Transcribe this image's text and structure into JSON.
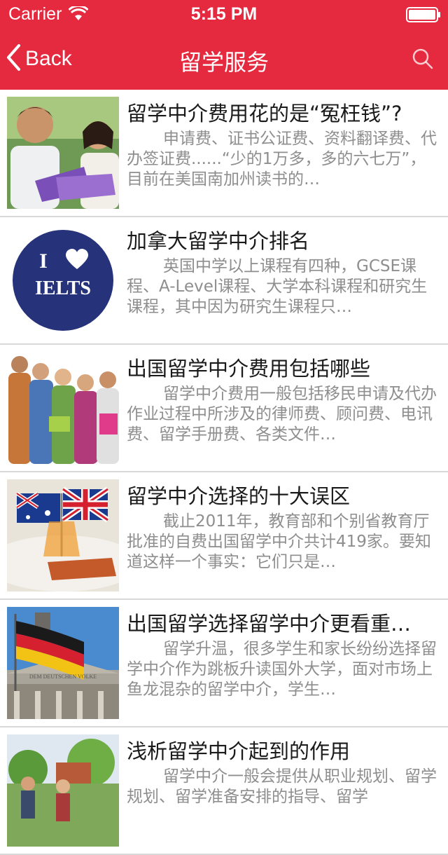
{
  "status_bar": {
    "carrier": "Carrier",
    "time": "5:15 PM"
  },
  "nav": {
    "back_label": "Back",
    "title": "留学服务"
  },
  "colors": {
    "header_bg": "#e5293f",
    "title_text": "#1a1a1a",
    "desc_text": "#8e8e8e",
    "divider": "#d8d8d8"
  },
  "articles": [
    {
      "title": "留学中介费用花的是“冤枉钱”?",
      "summary": "申请费、证书公证费、资料翻译费、代办签证费......“少的1万多，多的六七万”，目前在美国南加州读书的…",
      "image": "students-studying-photo"
    },
    {
      "title": "加拿大留学中介排名",
      "summary": "英国中学以上课程有四种，GCSE课程、A-Level课程、大学本科课程和研究生课程，其中因为研究生课程只…",
      "image": "i-love-ielts-logo",
      "logo_text": "I ♥ IELTS"
    },
    {
      "title": "出国留学中介费用包括哪些",
      "summary": "留学中介费用一般包括移民申请及代办作业过程中所涉及的律师费、顾问费、电讯费、留学手册费、各类文件…",
      "image": "student-group-photo"
    },
    {
      "title": "留学中介选择的十大误区",
      "summary": "截止2011年，教育部和个别省教育厅批准的自费出国留学中介共计419家。要知道这样一个事实：它们只是…",
      "image": "australia-uk-flags-photo"
    },
    {
      "title": "出国留学选择留学中介更看重…",
      "summary": "留学升温，很多学生和家长纷纷选择留学中介作为跳板升读国外大学，面对市场上鱼龙混杂的留学中介，学生…",
      "image": "german-flag-reichstag-photo",
      "photo_text": "DEM DEUTSCHEN VOLKE"
    },
    {
      "title": "浅析留学中介起到的作用",
      "summary": "留学中介一般会提供从职业规划、留学规划、留学准备安排的指导、留学",
      "image": "campus-students-photo"
    }
  ]
}
